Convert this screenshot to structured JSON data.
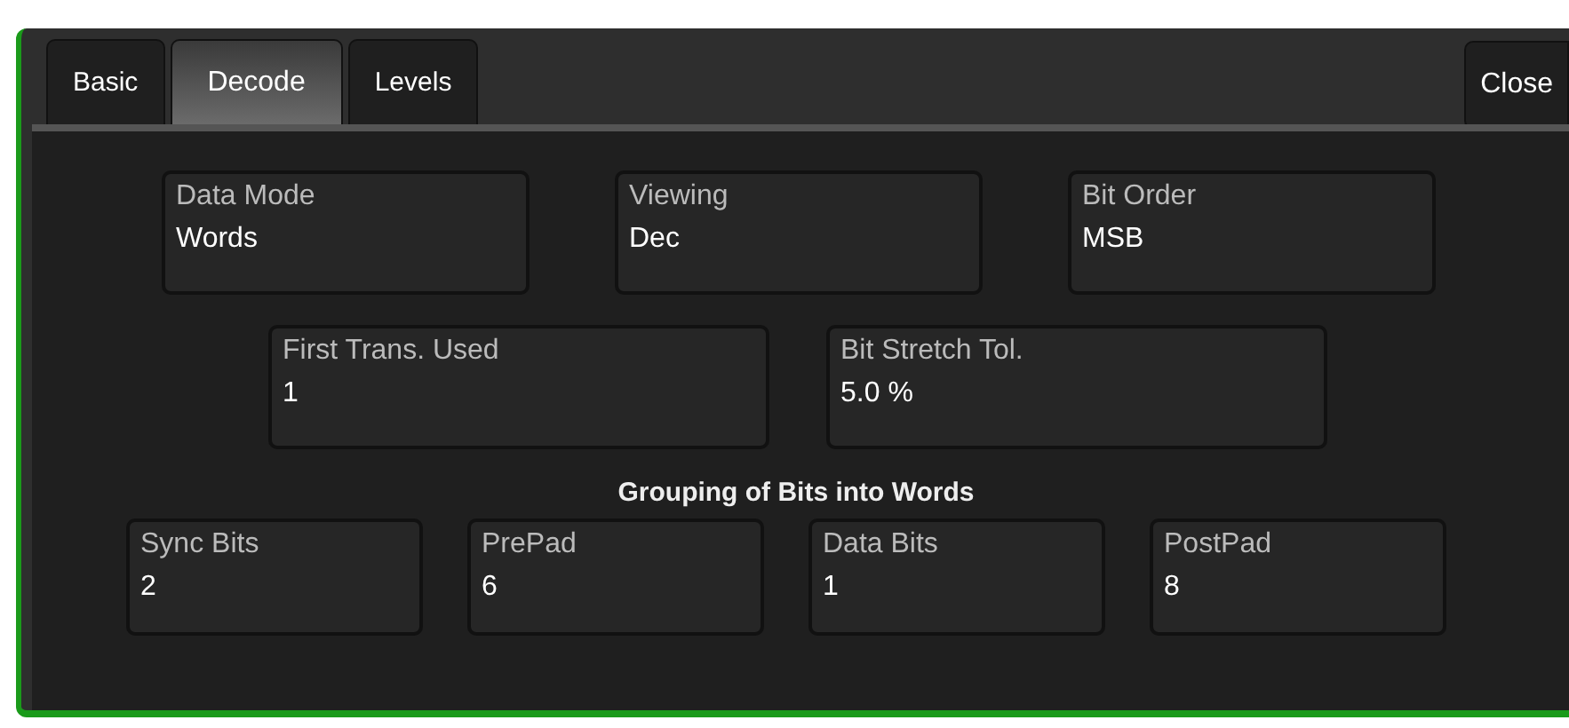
{
  "tabs": [
    {
      "label": "Basic",
      "selected": false
    },
    {
      "label": "Decode",
      "selected": true
    },
    {
      "label": "Levels",
      "selected": false
    }
  ],
  "close_button": "Close",
  "rows": [
    [
      {
        "label": "Data Mode",
        "value": "Words"
      },
      {
        "label": "Viewing",
        "value": "Dec"
      },
      {
        "label": "Bit Order",
        "value": "MSB"
      }
    ],
    [
      {
        "label": "First Trans. Used",
        "value": "1"
      },
      {
        "label": "Bit Stretch Tol.",
        "value": "5.0 %"
      }
    ]
  ],
  "grouping": {
    "heading": "Grouping of Bits into Words",
    "fields": [
      {
        "label": "Sync Bits",
        "value": "2"
      },
      {
        "label": "PrePad",
        "value": "6"
      },
      {
        "label": "Data Bits",
        "value": "1"
      },
      {
        "label": "PostPad",
        "value": "8"
      }
    ]
  }
}
